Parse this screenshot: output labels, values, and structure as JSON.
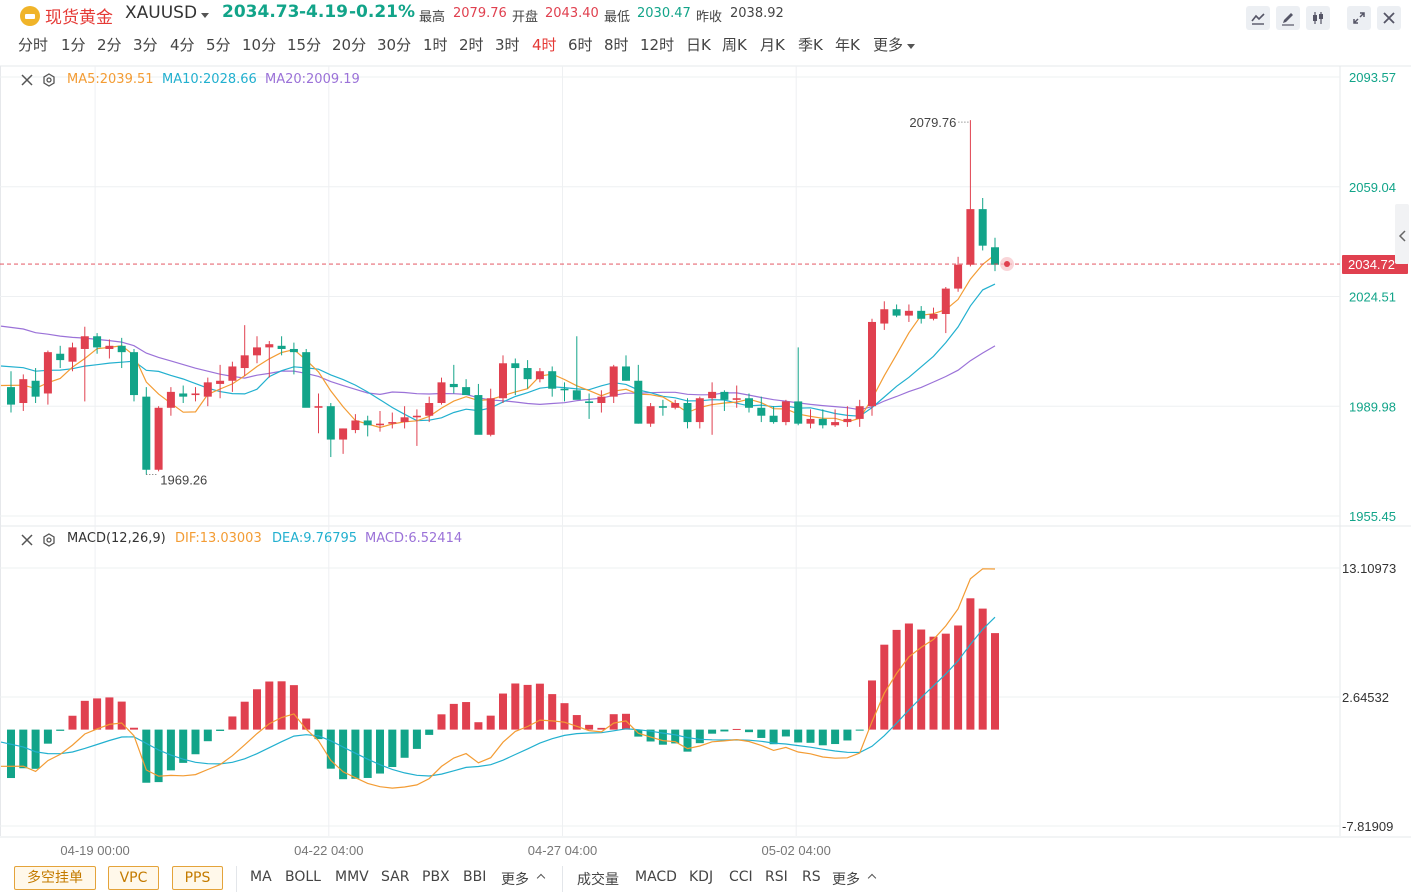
{
  "header": {
    "name": "现货黄金",
    "symbol": "XAUUSD",
    "price": "2034.73",
    "change": "-4.19",
    "change_pct": "-0.21%",
    "high_label": "最高",
    "high": "2079.76",
    "open_label": "开盘",
    "open": "2043.40",
    "low_label": "最低",
    "low": "2030.47",
    "prev_label": "昨收",
    "prev": "2038.92",
    "tools": [
      "line-tool-icon",
      "draw-tool-icon",
      "candle-style-icon",
      "fullscreen-icon",
      "close-icon"
    ]
  },
  "periods": [
    "分时",
    "1分",
    "2分",
    "3分",
    "4分",
    "5分",
    "10分",
    "15分",
    "20分",
    "30分",
    "1时",
    "2时",
    "3时",
    "4时",
    "6时",
    "8时",
    "12时",
    "日K",
    "周K",
    "月K",
    "季K",
    "年K",
    "更多"
  ],
  "active_period": "4时",
  "colors": {
    "up": "#e0404f",
    "down": "#12a489",
    "ma5": "#f39c34",
    "ma10": "#22b0cf",
    "ma20": "#9b72d8",
    "last_price": "#e0404f"
  },
  "main_legend": {
    "ma5": "MA5:2039.51",
    "ma10": "MA10:2028.66",
    "ma20": "MA20:2009.19"
  },
  "price_axis": [
    "2093.57",
    "2059.04",
    "2024.51",
    "1989.98",
    "1955.45"
  ],
  "last_price_label": "2034.72",
  "max_marker": "2079.76",
  "min_marker": "1969.26",
  "macd_legend": {
    "name": "MACD(12,26,9)",
    "dif": "DIF:13.03003",
    "dea": "DEA:9.76795",
    "macd": "MACD:6.52414"
  },
  "macd_axis": [
    "13.10973",
    "2.64532",
    "-7.81909"
  ],
  "time_axis": [
    "04-19 00:00",
    "04-22 04:00",
    "04-27 04:00",
    "05-02 04:00"
  ],
  "bottom": {
    "buttons": [
      "多空挂单",
      "VPC",
      "PPS"
    ],
    "main_indicators": [
      "MA",
      "BOLL",
      "MMV",
      "SAR",
      "PBX",
      "BBI",
      "更多"
    ],
    "sub_indicators": [
      "成交量",
      "MACD",
      "KDJ",
      "CCI",
      "RSI",
      "RS",
      "更多"
    ]
  },
  "chart_data": {
    "type": "candlestick",
    "timeframe": "4时",
    "price_axis_range": [
      1955.45,
      2093.57
    ],
    "candles": [
      [
        1996.0,
        2001.0,
        1988.0,
        1990.5
      ],
      [
        1991.0,
        2000.0,
        1988.5,
        1998.5
      ],
      [
        1998.0,
        2002.0,
        1991.0,
        1993.0
      ],
      [
        1994.0,
        2007.5,
        1990.5,
        2007.0
      ],
      [
        2006.5,
        2009.0,
        2002.0,
        2004.5
      ],
      [
        2004.0,
        2010.0,
        2001.0,
        2008.5
      ],
      [
        2008.0,
        2015.0,
        1991.5,
        2012.0
      ],
      [
        2012.0,
        2013.0,
        2006.5,
        2008.5
      ],
      [
        2008.0,
        2011.0,
        2005.0,
        2009.0
      ],
      [
        2009.0,
        2011.5,
        2002.0,
        2007.0
      ],
      [
        2007.0,
        2008.0,
        1991.5,
        1993.5
      ],
      [
        1993.0,
        1996.0,
        1968.5,
        1970.0
      ],
      [
        1970.0,
        1990.0,
        1969.5,
        1989.5
      ],
      [
        1989.5,
        1996.0,
        1987.0,
        1994.5
      ],
      [
        1994.0,
        1996.5,
        1991.0,
        1993.0
      ],
      [
        1993.5,
        1996.0,
        1991.5,
        1994.0
      ],
      [
        1993.0,
        1999.0,
        1990.0,
        1997.5
      ],
      [
        1997.0,
        2003.0,
        1992.5,
        1998.0
      ],
      [
        1998.0,
        2004.0,
        1994.5,
        2002.5
      ],
      [
        2002.0,
        2015.5,
        1999.5,
        2006.0
      ],
      [
        2006.0,
        2012.0,
        2003.5,
        2008.5
      ],
      [
        2008.5,
        2010.5,
        1999.0,
        2009.5
      ],
      [
        2009.0,
        2012.0,
        2006.0,
        2008.0
      ],
      [
        2008.0,
        2010.0,
        2000.0,
        2007.0
      ],
      [
        2007.0,
        2008.0,
        1991.0,
        1989.5
      ],
      [
        1989.5,
        1994.0,
        1981.5,
        1990.0
      ],
      [
        1990.0,
        1991.0,
        1974.0,
        1979.5
      ],
      [
        1979.5,
        1983.0,
        1975.0,
        1983.0
      ],
      [
        1982.5,
        1987.5,
        1981.5,
        1985.5
      ],
      [
        1985.5,
        1987.0,
        1980.5,
        1984.0
      ],
      [
        1984.0,
        1988.5,
        1982.0,
        1984.5
      ],
      [
        1984.5,
        1988.0,
        1983.0,
        1985.0
      ],
      [
        1985.0,
        1990.0,
        1983.0,
        1986.5
      ],
      [
        1986.5,
        1989.0,
        1977.5,
        1987.0
      ],
      [
        1987.0,
        1993.0,
        1985.0,
        1991.0
      ],
      [
        1991.0,
        1999.0,
        1990.5,
        1997.5
      ],
      [
        1997.0,
        2003.0,
        1994.0,
        1996.0
      ],
      [
        1996.0,
        1998.5,
        1993.5,
        1993.5
      ],
      [
        1993.5,
        1997.0,
        1981.5,
        1981.0
      ],
      [
        1981.0,
        1995.5,
        1980.5,
        1992.5
      ],
      [
        1992.5,
        2006.0,
        1991.0,
        2003.5
      ],
      [
        2003.5,
        2005.0,
        1993.5,
        2002.0
      ],
      [
        2002.0,
        2004.5,
        1995.5,
        1998.5
      ],
      [
        1998.5,
        2002.0,
        1997.5,
        2001.0
      ],
      [
        2001.0,
        2002.5,
        1993.0,
        1995.5
      ],
      [
        1995.5,
        1997.5,
        1991.5,
        1995.0
      ],
      [
        1995.0,
        2012.0,
        1994.5,
        1992.0
      ],
      [
        1991.5,
        1994.0,
        1986.0,
        1991.0
      ],
      [
        1991.0,
        1995.0,
        1988.0,
        1993.0
      ],
      [
        1993.0,
        2003.0,
        1991.0,
        2002.5
      ],
      [
        2002.5,
        2006.0,
        1998.0,
        1998.0
      ],
      [
        1998.0,
        2003.0,
        1984.5,
        1984.5
      ],
      [
        1984.5,
        1991.0,
        1983.5,
        1990.0
      ],
      [
        1990.0,
        1992.0,
        1987.0,
        1989.5
      ],
      [
        1989.5,
        1992.0,
        1989.0,
        1991.0
      ],
      [
        1991.0,
        1992.5,
        1983.0,
        1985.0
      ],
      [
        1985.0,
        1993.0,
        1983.0,
        1992.5
      ],
      [
        1992.5,
        1997.5,
        1981.0,
        1994.5
      ],
      [
        1994.5,
        1995.0,
        1988.5,
        1992.0
      ],
      [
        1992.0,
        1996.5,
        1989.5,
        1992.5
      ],
      [
        1992.5,
        1994.0,
        1988.0,
        1989.5
      ],
      [
        1989.5,
        1993.0,
        1985.0,
        1987.0
      ],
      [
        1987.0,
        1990.0,
        1984.5,
        1985.0
      ],
      [
        1985.0,
        1992.0,
        1984.0,
        1991.5
      ],
      [
        1991.5,
        2008.5,
        1984.0,
        1984.5
      ],
      [
        1984.5,
        1989.0,
        1983.0,
        1986.0
      ],
      [
        1986.0,
        1989.0,
        1983.0,
        1984.0
      ],
      [
        1984.0,
        1989.0,
        1983.5,
        1985.0
      ],
      [
        1985.0,
        1990.0,
        1983.5,
        1986.0
      ],
      [
        1986.0,
        1992.0,
        1983.5,
        1990.0
      ],
      [
        1990.0,
        2017.5,
        1987.0,
        2016.5
      ],
      [
        2016.0,
        2023.0,
        2014.0,
        2020.5
      ],
      [
        2020.5,
        2022.0,
        2018.0,
        2018.5
      ],
      [
        2018.5,
        2022.0,
        2016.5,
        2020.0
      ],
      [
        2020.0,
        2021.5,
        2016.0,
        2017.5
      ],
      [
        2017.5,
        2021.0,
        2017.0,
        2019.0
      ],
      [
        2019.0,
        2027.5,
        2013.0,
        2027.0
      ],
      [
        2027.0,
        2037.0,
        2026.0,
        2034.5
      ],
      [
        2034.5,
        2080.0,
        2034.0,
        2052.0
      ],
      [
        2052.0,
        2055.5,
        2039.0,
        2040.5
      ],
      [
        2040.0,
        2043.0,
        2032.5,
        2034.5
      ]
    ],
    "macd_axis_range": [
      -7.81909,
      13.10973
    ],
    "macd": {
      "dif": 13.03003,
      "dea": 9.76795,
      "macd": 6.52414
    }
  }
}
